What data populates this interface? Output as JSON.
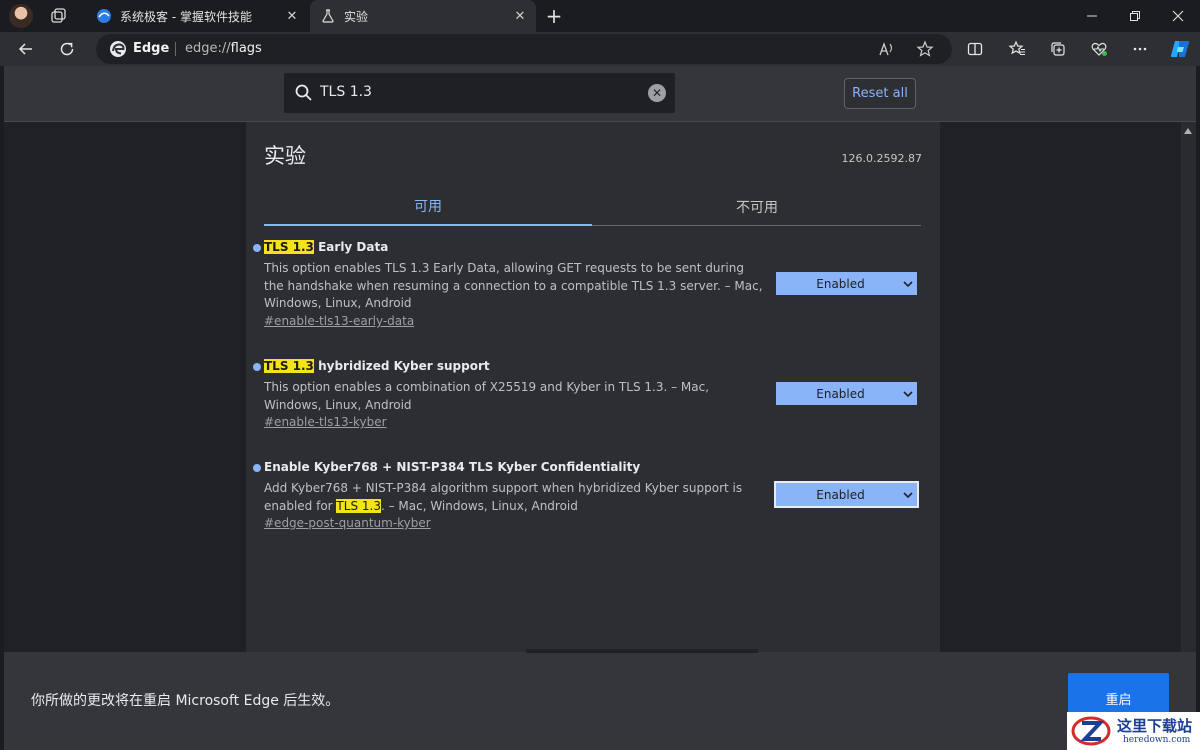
{
  "tabs": [
    {
      "title": "系统极客 - 掌握软件技能",
      "favicon": "site-favicon-icon"
    },
    {
      "title": "实验",
      "favicon": "flask-icon",
      "active": true
    }
  ],
  "toolbar": {
    "site_label": "Edge",
    "url_prefix": "edge://",
    "url_host": "flags"
  },
  "flags": {
    "search": {
      "value": "TLS 1.3"
    },
    "reset_all_label": "Reset all",
    "page_title": "实验",
    "version": "126.0.2592.87",
    "tab_available": "可用",
    "tab_unavailable": "不可用",
    "experiments": [
      {
        "title_highlight": "TLS 1.3",
        "title_rest": " Early Data",
        "description": "This option enables TLS 1.3 Early Data, allowing GET requests to be sent during the handshake when resuming a connection to a compatible TLS 1.3 server. – Mac, Windows, Linux, Android",
        "link": "#enable-tls13-early-data",
        "state": "Enabled"
      },
      {
        "title_highlight": "TLS 1.3",
        "title_rest": " hybridized Kyber support",
        "description": "This option enables a combination of X25519 and Kyber in TLS 1.3. – Mac, Windows, Linux, Android",
        "link": "#enable-tls13-kyber",
        "state": "Enabled"
      },
      {
        "title": "Enable Kyber768 + NIST-P384 TLS Kyber Confidentiality",
        "description_pre": "Add Kyber768 + NIST-P384 algorithm support when hybridized Kyber support is enabled for ",
        "description_highlight": "TLS 1.3",
        "description_post": ". – Mac, Windows, Linux, Android",
        "link": "#edge-post-quantum-kyber",
        "state": "Enabled"
      }
    ]
  },
  "restart_bar": {
    "message": "你所做的更改将在重启 Microsoft Edge 后生效。",
    "button_label": "重启"
  },
  "watermark": {
    "text_cn": "这里下载站",
    "text_en": "heredown.com"
  },
  "colors": {
    "accent": "#8ab4f8",
    "highlight": "#f5e31a",
    "restart_button": "#1a73e8"
  }
}
